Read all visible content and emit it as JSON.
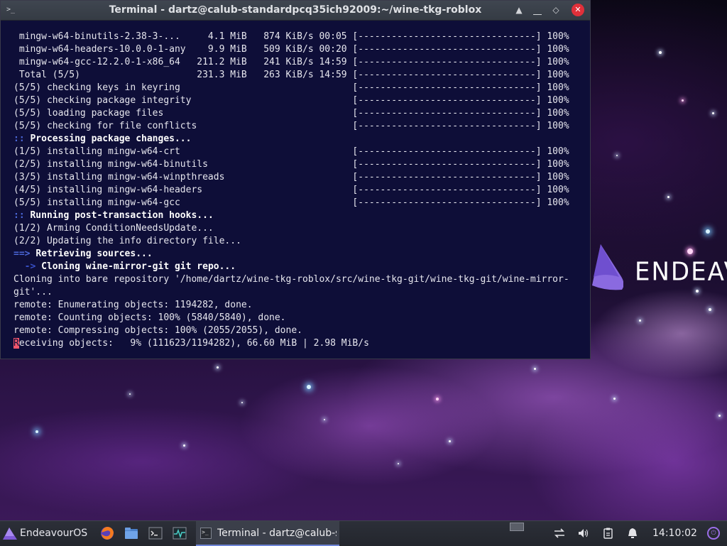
{
  "window": {
    "title": "Terminal - dartz@calub-standardpcq35ich92009:~/wine-tkg-roblox",
    "app_icon": "terminal-icon",
    "controls": {
      "shade": "▲",
      "minimize": "⎽",
      "maximize": "◇",
      "close": "✕"
    }
  },
  "terminal": {
    "lines": [
      {
        "text": " mingw-w64-binutils-2.38-3-...     4.1 MiB   874 KiB/s 00:05 [--------------------------------] 100%",
        "style": "normal"
      },
      {
        "text": " mingw-w64-headers-10.0.0-1-any    9.9 MiB   509 KiB/s 00:20 [--------------------------------] 100%",
        "style": "normal"
      },
      {
        "text": " mingw-w64-gcc-12.2.0-1-x86_64   211.2 MiB   241 KiB/s 14:59 [--------------------------------] 100%",
        "style": "normal"
      },
      {
        "text": " Total (5/5)                     231.3 MiB   263 KiB/s 14:59 [--------------------------------] 100%",
        "style": "normal"
      },
      {
        "text": "(5/5) checking keys in keyring                               [--------------------------------] 100%",
        "style": "normal"
      },
      {
        "text": "(5/5) checking package integrity                             [--------------------------------] 100%",
        "style": "normal"
      },
      {
        "text": "(5/5) loading package files                                  [--------------------------------] 100%",
        "style": "normal"
      },
      {
        "text": "(5/5) checking for file conflicts                            [--------------------------------] 100%",
        "style": "normal"
      },
      {
        "prefix": ":: ",
        "text": "Processing package changes...",
        "style": "header"
      },
      {
        "text": "(1/5) installing mingw-w64-crt                               [--------------------------------] 100%",
        "style": "normal"
      },
      {
        "text": "(2/5) installing mingw-w64-binutils                          [--------------------------------] 100%",
        "style": "normal"
      },
      {
        "text": "(3/5) installing mingw-w64-winpthreads                       [--------------------------------] 100%",
        "style": "normal"
      },
      {
        "text": "(4/5) installing mingw-w64-headers                           [--------------------------------] 100%",
        "style": "normal"
      },
      {
        "text": "(5/5) installing mingw-w64-gcc                               [--------------------------------] 100%",
        "style": "normal"
      },
      {
        "prefix": ":: ",
        "text": "Running post-transaction hooks...",
        "style": "header"
      },
      {
        "text": "(1/2) Arming ConditionNeedsUpdate...",
        "style": "normal"
      },
      {
        "text": "(2/2) Updating the info directory file...",
        "style": "normal"
      },
      {
        "prefix": "==> ",
        "text": "Retrieving sources...",
        "style": "header"
      },
      {
        "prefix": "  -> ",
        "text": "Cloning wine-mirror-git git repo...",
        "style": "header2"
      },
      {
        "text": "Cloning into bare repository '/home/dartz/wine-tkg-roblox/src/wine-tkg-git/wine-tkg-git/wine-mirror-",
        "style": "normal"
      },
      {
        "text": "git'...",
        "style": "normal"
      },
      {
        "text": "remote: Enumerating objects: 1194282, done.",
        "style": "normal"
      },
      {
        "text": "remote: Counting objects: 100% (5840/5840), done.",
        "style": "normal"
      },
      {
        "text": "remote: Compressing objects: 100% (2055/2055), done.",
        "style": "normal"
      },
      {
        "cursor": "R",
        "text": "eceiving objects:   9% (111623/1194282), 66.60 MiB | 2.98 MiB/s",
        "style": "cursor"
      }
    ]
  },
  "desktop": {
    "logo_text": "ENDEAVOUR",
    "brand_color": "#7f5ad8"
  },
  "taskbar": {
    "menu_label": "EndeavourOS",
    "launchers": [
      "firefox-icon",
      "file-manager-icon",
      "terminal-icon",
      "system-monitor-icon"
    ],
    "task_label": "Terminal - dartz@calub-st...",
    "tray_icons": [
      "network-icon",
      "volume-icon",
      "clipboard-icon",
      "notification-icon",
      "logout-icon"
    ],
    "clock": "14:10:02"
  }
}
